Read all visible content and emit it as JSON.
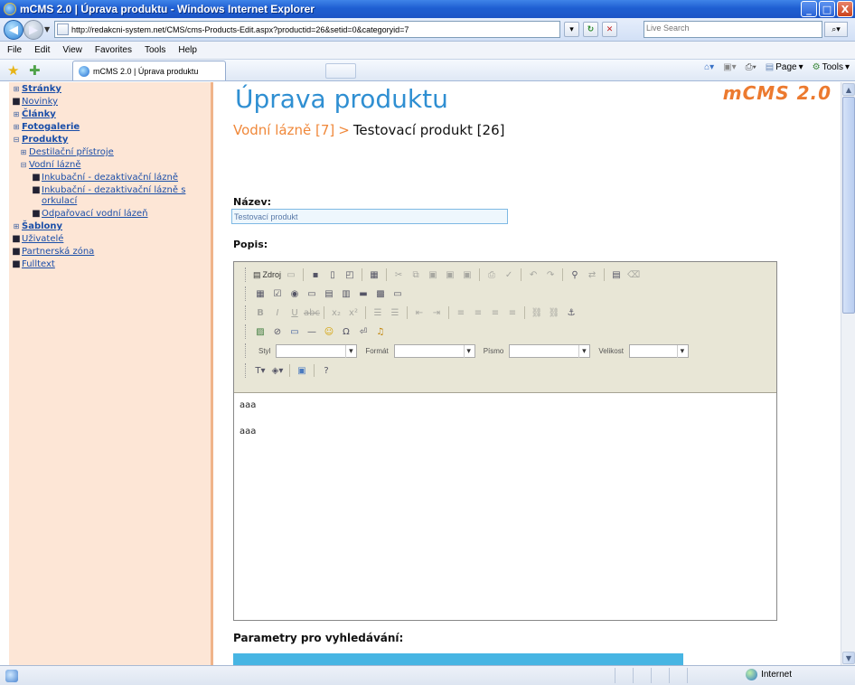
{
  "window": {
    "title": "mCMS 2.0 | Úprava produktu - Windows Internet Explorer",
    "minimize": "_",
    "maximize": "□",
    "close": "X"
  },
  "address": {
    "url": "http://redakcni-system.net/CMS/cms-Products-Edit.aspx?productid=26&setid=0&categoryid=7",
    "search_placeholder": "Live Search"
  },
  "menu": [
    "File",
    "Edit",
    "View",
    "Favorites",
    "Tools",
    "Help"
  ],
  "tab": {
    "label": "mCMS 2.0 | Úprava produktu"
  },
  "commandbar": {
    "page": "Page",
    "tools": "Tools"
  },
  "sidebar": {
    "items": [
      {
        "label": "Stránky",
        "marker": "⊞",
        "bold": true
      },
      {
        "label": "Novinky",
        "marker": "■",
        "bold": false
      },
      {
        "label": "Články",
        "marker": "⊞",
        "bold": true
      },
      {
        "label": "Fotogalerie",
        "marker": "⊞",
        "bold": true
      },
      {
        "label": "Produkty",
        "marker": "⊟",
        "bold": true
      },
      {
        "label": "Destilační přístroje",
        "marker": "⊞",
        "level": 1
      },
      {
        "label": "Vodní lázně",
        "marker": "⊟",
        "level": 1
      },
      {
        "label": "Inkubační - dezaktivační lázně",
        "marker": "■",
        "level": 2
      },
      {
        "label": "Inkubační - dezaktivační lázně s orkulací",
        "marker": "■",
        "level": 2
      },
      {
        "label": "Odpařovací vodní lázeň",
        "marker": "■",
        "level": 2
      },
      {
        "label": "Šablony",
        "marker": "⊞",
        "bold": true
      },
      {
        "label": "Uživatelé",
        "marker": "■",
        "bold": false
      },
      {
        "label": "Partnerská zóna",
        "marker": "■",
        "bold": false
      },
      {
        "label": "Fulltext",
        "marker": "■",
        "bold": false
      }
    ]
  },
  "main": {
    "logo": "mCMS 2.0",
    "title": "Úprava produktu",
    "breadcrumb": {
      "category": "Vodní lázně [7]",
      "separator": ">",
      "current": "Testovací produkt [26]"
    },
    "name_label": "Název:",
    "name_value": "Testovací produkt",
    "desc_label": "Popis:",
    "editor": {
      "source_label": "Zdroj",
      "style_label": "Styl",
      "format_label": "Formát",
      "font_label": "Písmo",
      "size_label": "Velikost",
      "content": [
        "aaa",
        "aaa"
      ]
    },
    "params_title": "Parametry pro vyhledávání:"
  },
  "status": {
    "zone": "Internet"
  },
  "colors": {
    "title_blue": "#2f8fd2",
    "breadcrumb_orange": "#f0883a",
    "sidebar_bg": "#fde6d6",
    "logo_orange": "#ec7a2f"
  }
}
